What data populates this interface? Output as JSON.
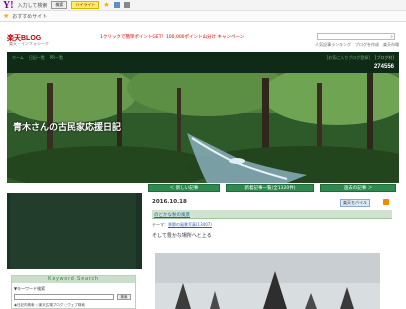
{
  "toolbar": {
    "yahoo_glyph": "Y!",
    "search_hint": "入力して検索",
    "search_button": "検索",
    "highlight": "ハイライト",
    "bookmark_label": "おすすめサイト"
  },
  "header": {
    "logo": "楽天BLOG",
    "logo_sub": "楽天・インフォシーク",
    "promo": "1クリックで簡単ポイントGET！100,000ポイント山分け キャンペーン",
    "ranking_link": "人気記事ランキング",
    "blog_start_link": "ブログを作成",
    "login_link": "楽天市場"
  },
  "blog_nav": {
    "left_links": [
      "ホーム",
      "日記一覧",
      "PR一覧"
    ],
    "right_links": [
      "[お気に入りブログ登録]",
      "[ブログ村]"
    ],
    "visitor_count": "274556"
  },
  "banner": {
    "title": "青木さんの古民家応援日記"
  },
  "nav_buttons": {
    "prev": "＜ 新しい記事",
    "list": "新着記事一覧(全1320件)",
    "next": "過去の記事 ＞"
  },
  "sidebar": {
    "keyword_heading": "Keyword Search",
    "keyword_label": "▼キーワード検索",
    "search_button": "検索",
    "radio_options": "◉日記内検索 ○楽天広場ブログ ○ウェブ検索"
  },
  "article": {
    "date": "2016.10.18",
    "mobile_label": "楽天モバイル",
    "title": "のどかな秋の風景",
    "theme_prefix": "テーマ：",
    "theme_link": "季節の風景写真(13407)",
    "text": "そして豊かな場所へと上る"
  }
}
